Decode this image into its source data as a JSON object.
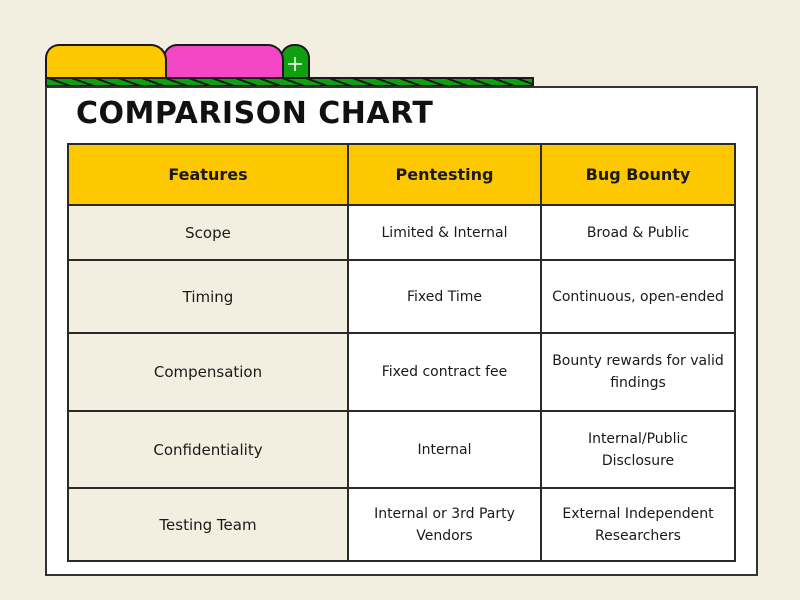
{
  "colors": {
    "background": "#f3efe0",
    "header_fill": "#fdc800",
    "tab_yellow": "#fdc800",
    "tab_pink": "#f546c5",
    "tab_green": "#0fa010",
    "feature_column_fill": "#f3efe0",
    "border": "#1a1a1a"
  },
  "tabs": [
    {
      "name": "yellow-tab",
      "label": ""
    },
    {
      "name": "pink-tab",
      "label": ""
    },
    {
      "name": "add-tab",
      "icon": "plus-icon"
    }
  ],
  "title": "COMPARISON CHART",
  "table": {
    "headers": [
      "Features",
      "Pentesting",
      "Bug Bounty"
    ],
    "rows": [
      [
        "Scope",
        "Limited & Internal",
        "Broad & Public"
      ],
      [
        "Timing",
        "Fixed Time",
        "Continuous, open-ended"
      ],
      [
        "Compensation",
        "Fixed contract fee",
        "Bounty rewards for valid findings"
      ],
      [
        "Confidentiality",
        "Internal",
        "Internal/Public Disclosure"
      ],
      [
        "Testing Team",
        "Internal or 3rd Party Vendors",
        "External Independent Researchers"
      ]
    ]
  }
}
